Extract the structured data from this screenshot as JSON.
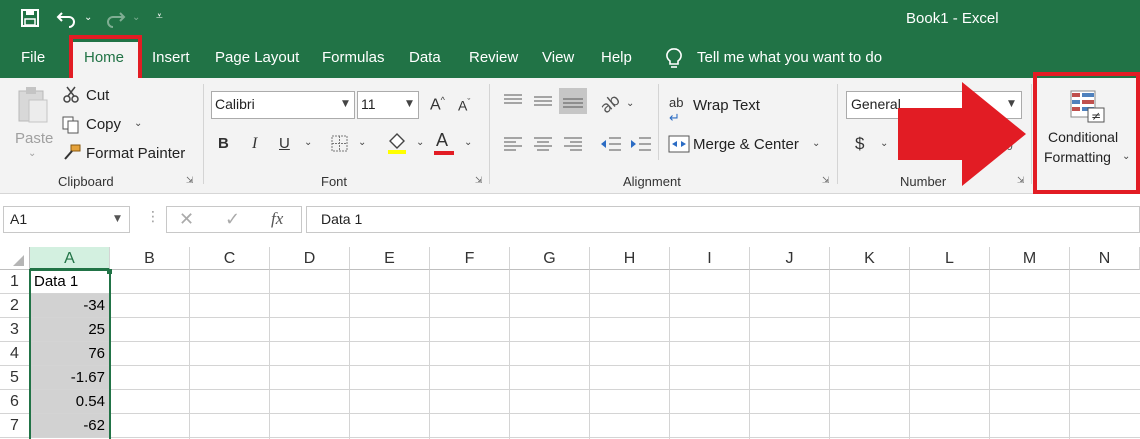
{
  "app": {
    "title": "Book1  -  Excel"
  },
  "tabs": [
    "File",
    "Home",
    "Insert",
    "Page Layout",
    "Formulas",
    "Data",
    "Review",
    "View",
    "Help"
  ],
  "tell_me": "Tell me what you want to do",
  "clipboard": {
    "paste": "Paste",
    "cut": "Cut",
    "copy": "Copy",
    "format_painter": "Format Painter",
    "group": "Clipboard"
  },
  "font": {
    "name": "Calibri",
    "size": "11",
    "bold": "B",
    "italic": "I",
    "underline": "U",
    "group": "Font"
  },
  "alignment": {
    "wrap_text": "Wrap Text",
    "merge_center": "Merge & Center",
    "group": "Alignment"
  },
  "number": {
    "format": "General",
    "currency": "$",
    "group": "Number"
  },
  "styles": {
    "cf_line1": "Conditional",
    "cf_line2": "Formatting"
  },
  "formula_bar": {
    "name_box": "A1",
    "fx": "fx",
    "value": "Data 1"
  },
  "sheet": {
    "columns": [
      "A",
      "B",
      "C",
      "D",
      "E",
      "F",
      "G",
      "H",
      "I",
      "J",
      "K",
      "L",
      "M",
      "N"
    ],
    "rows": [
      "1",
      "2",
      "3",
      "4",
      "5",
      "6",
      "7"
    ],
    "col_a": [
      "Data 1",
      "-34",
      "25",
      "76",
      "-1.67",
      "0.54",
      "-62"
    ]
  },
  "colors": {
    "excel_green": "#217346",
    "highlight_red": "#e21c24",
    "selection": "#d2d2d2"
  }
}
